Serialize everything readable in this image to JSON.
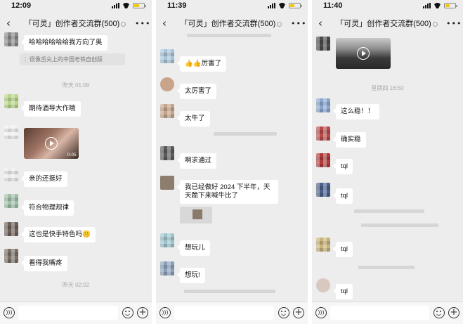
{
  "screens": [
    {
      "time": "12:09",
      "title": "「可灵」创作者交流群(500)",
      "messages": {
        "m1": "哈哈哈哈哈给我方向了奥",
        "quote": "：很像舌尖上的中国老铁自创版",
        "ts1": "昨天 01:09",
        "m2": "期待酒导大作哦",
        "video_dur": "0:05",
        "m3": "亲的还挺好",
        "m4": "符合物理规律",
        "m5": "这也是快手特色吗🤫",
        "m6": "看得我嘴疼",
        "ts2": "昨天 02:02"
      }
    },
    {
      "time": "11:39",
      "title": "「可灵」创作者交流群(500)",
      "messages": {
        "m1": "👍👍厉害了",
        "m2": "太厉害了",
        "m3": "太牛了",
        "m4": "啊求通过",
        "m5": "我已经做好 2024 下半年，天天跪下来喊牛比了",
        "m6": "想玩儿",
        "m7": "想玩!"
      }
    },
    {
      "time": "11:40",
      "title": "「可灵」创作者交流群(500)",
      "messages": {
        "ts1": "星期四 16:50",
        "m1": "这么稳！！",
        "m2": "确实稳",
        "m3": "tql",
        "m4": "tql",
        "m5": "tql",
        "m6": "tql"
      }
    }
  ],
  "colors": {
    "chat_bg": "#ededed",
    "bubble_bg": "#ffffff",
    "timestamp": "#a8a8a8"
  },
  "icons": {
    "back": "chevron-left-icon",
    "more": "more-dots-icon",
    "voice": "voice-icon",
    "emoji": "emoji-icon",
    "plus": "plus-icon"
  }
}
